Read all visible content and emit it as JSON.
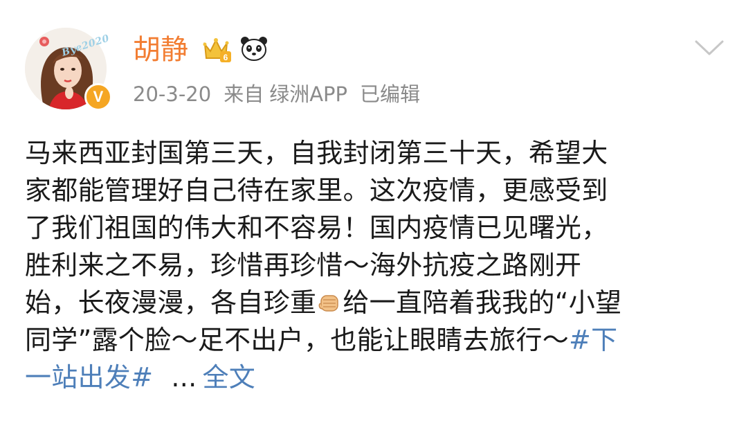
{
  "post": {
    "avatar_caption": "Bye2020",
    "verified_mark": "V",
    "username": "胡静",
    "crown_level": "6",
    "timestamp": "20-3-20",
    "source_prefix": "来自",
    "source": "绿洲APP",
    "edited": "已编辑",
    "lines": [
      "马来西亚封国第三天，自我封闭第三十天，希望大",
      "家都能管理好自己待在家里。这次疫情，更感受到",
      "了我们祖国的伟大和不容易！国内疫情已见曙光，",
      "胜利来之不易，珍惜再珍惜～海外抗疫之路刚开"
    ],
    "line5_before_emoji": "始，长夜漫漫，各自珍重",
    "line5_after_emoji": "给一直陪着我我的“小望",
    "line6_text": "同学”露个脸～足不出户，也能让眼睛去旅行～",
    "hashtag_part1": "#下",
    "hashtag_part2": "一站出发#",
    "ellipsis": "...",
    "full_text_link": "全文"
  },
  "icons": {
    "verified": "verified-v-icon",
    "crown": "crown-level-badge-icon",
    "panda": "panda-icon",
    "chevron": "chevron-down-icon",
    "fist": "fist-emoji-icon"
  },
  "colors": {
    "username": "#f27d32",
    "meta": "#8a8a8a",
    "link": "#4e7fb9",
    "verified": "#f5a623"
  }
}
